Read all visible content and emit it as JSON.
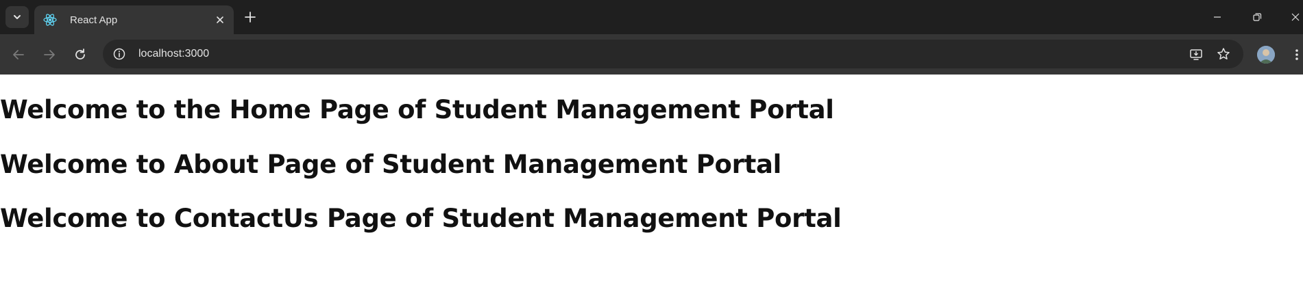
{
  "browser": {
    "tab_title": "React App",
    "url": "localhost:3000",
    "icons": [
      "tab-search-icon",
      "react-icon",
      "close-icon",
      "plus-icon",
      "minimize-icon",
      "restore-icon",
      "window-close-icon",
      "back-arrow-icon",
      "forward-arrow-icon",
      "reload-icon",
      "site-info-icon",
      "install-app-icon",
      "star-icon",
      "profile-avatar",
      "more-menu-icon"
    ]
  },
  "page": {
    "heading_home": "Welcome to the Home Page of Student Management Portal",
    "heading_about": "Welcome to About Page of Student Management Portal",
    "heading_contact": "Welcome to ContactUs Page of Student Management Portal"
  },
  "colors": {
    "tabstrip_bg": "#1f1f1f",
    "toolbar_bg": "#353535",
    "omnibox_bg": "#282828",
    "page_bg": "#ffffff",
    "heading_text": "#111111"
  }
}
